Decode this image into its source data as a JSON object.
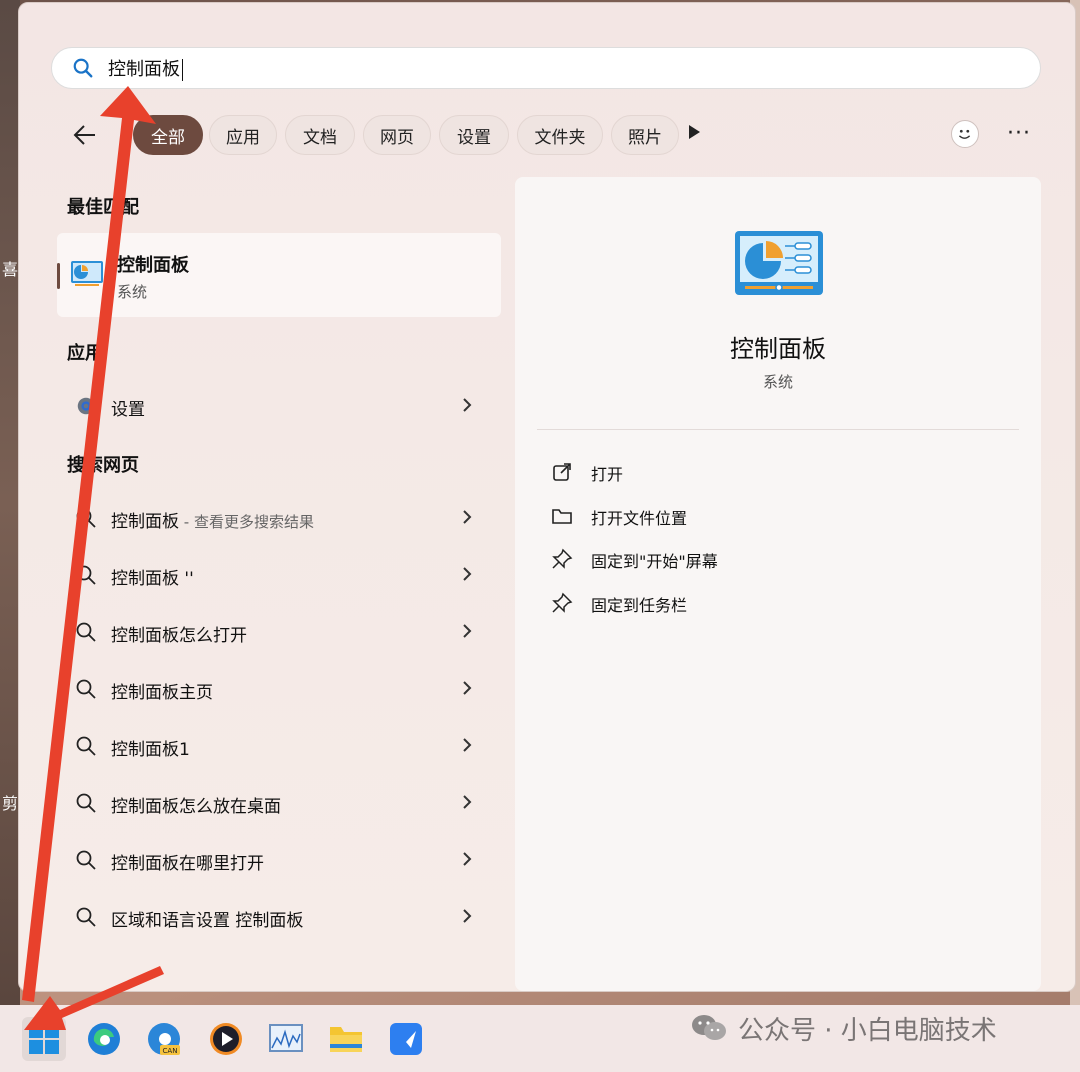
{
  "search": {
    "value": "控制面板"
  },
  "filters": {
    "items": [
      "全部",
      "应用",
      "文档",
      "网页",
      "设置",
      "文件夹",
      "照片"
    ],
    "active": "全部"
  },
  "sections": {
    "best": "最佳匹配",
    "apps": "应用",
    "web": "搜索网页"
  },
  "best_match": {
    "title": "控制面板",
    "subtitle": "系统"
  },
  "apps": [
    {
      "label": "设置"
    }
  ],
  "web_results": [
    {
      "label": "控制面板",
      "extra": " - 查看更多搜索结果"
    },
    {
      "label": "控制面板 ''",
      "extra": ""
    },
    {
      "label": "控制面板怎么打开",
      "extra": ""
    },
    {
      "label": "控制面板主页",
      "extra": ""
    },
    {
      "label": "控制面板1",
      "extra": ""
    },
    {
      "label": "控制面板怎么放在桌面",
      "extra": ""
    },
    {
      "label": "控制面板在哪里打开",
      "extra": ""
    },
    {
      "label": "区域和语言设置 控制面板",
      "extra": ""
    }
  ],
  "preview": {
    "title": "控制面板",
    "subtitle": "系统",
    "actions": [
      "打开",
      "打开文件位置",
      "固定到\"开始\"屏幕",
      "固定到任务栏"
    ]
  },
  "desktop_edge": {
    "label1": "喜",
    "label2": "剪"
  },
  "watermark": {
    "text": "公众号 · 小白电脑技术"
  },
  "colors": {
    "accent": "#6d4a3f",
    "annotation_arrow": "#e8412c"
  },
  "taskbar": {
    "icons": [
      "windows-start-icon",
      "edge-icon",
      "edge-canary-icon",
      "media-player-icon",
      "resource-monitor-icon",
      "file-explorer-icon",
      "feishu-icon"
    ]
  }
}
